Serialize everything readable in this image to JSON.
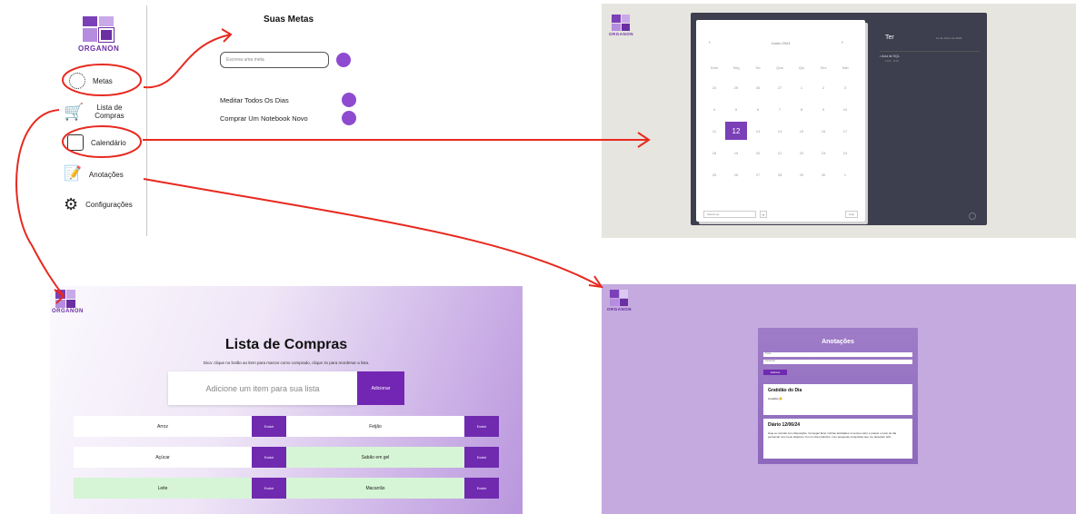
{
  "colors": {
    "brand": "#6b2fa3",
    "accent": "#7326b3",
    "annotation": "#e8291f",
    "notes_bg": "#c4aadf"
  },
  "logo": {
    "name": "ORGANON"
  },
  "goals_panel": {
    "title": "Suas Metas",
    "input_placeholder": "Escreva uma meta",
    "nav": [
      {
        "label": "Metas",
        "icon": "target-icon"
      },
      {
        "label": "Lista de Compras",
        "icon": "shopping-cart-icon"
      },
      {
        "label": "Calendário",
        "icon": "calendar-icon"
      },
      {
        "label": "Anotações",
        "icon": "notepad-icon"
      },
      {
        "label": "Configurações",
        "icon": "gear-icon"
      }
    ],
    "goals": [
      "Meditar Todos Os Dias",
      "Comprar Um Notebook Novo"
    ]
  },
  "calendar_panel": {
    "month_label": "Junho 2024",
    "weekdays": [
      "Dom",
      "Seg",
      "Ter",
      "Qua",
      "Qui",
      "Sex",
      "Sab"
    ],
    "weeks": [
      [
        "24",
        "25",
        "26",
        "27",
        "1",
        "2",
        "3"
      ],
      [
        "4",
        "5",
        "6",
        "7",
        "8",
        "9",
        "10"
      ],
      [
        "11",
        "12",
        "13",
        "14",
        "15",
        "16",
        "17"
      ],
      [
        "18",
        "19",
        "20",
        "21",
        "22",
        "23",
        "24"
      ],
      [
        "25",
        "26",
        "27",
        "28",
        "29",
        "30",
        "1"
      ]
    ],
    "selected_day": "12",
    "side_day": "Ter",
    "side_date": "12 de Junho de 2024",
    "event": "Aula de SQL",
    "event_time": "14:00 - 15:00",
    "select_label": "Selecione",
    "today_btn": "Hoje"
  },
  "shopping_panel": {
    "title": "Lista de Compras",
    "hint": "Dica: clique no botão ao item para marcar como comprado, clique 2x para reordenar a lista.",
    "input_placeholder": "Adicione um item para sua lista",
    "add_label": "Adicionar",
    "remove_label": "Excluir",
    "items": [
      {
        "label": "Arroz",
        "done": false
      },
      {
        "label": "Feijão",
        "done": false
      },
      {
        "label": "Açúcar",
        "done": false
      },
      {
        "label": "Sabão em gel",
        "done": true
      },
      {
        "label": "Leite",
        "done": true
      },
      {
        "label": "Macarrão",
        "done": true
      }
    ]
  },
  "notes_panel": {
    "title": "Anotações",
    "field1": "Título",
    "field2": "Conteúdo",
    "add_label": "Adicionar",
    "notes": [
      {
        "title": "Gratidão do Dia",
        "body": "Gratidão 😊"
      },
      {
        "title": "Diário 12/06/24",
        "body": "Hoje eu acordei com disposição. Consegui fazer minhas atividades no tempo certo e passei o resto do dia pensando nos meus objetivos. Foi um dia produtivo, com pequenas conquistas que me deixaram feliz."
      }
    ]
  }
}
